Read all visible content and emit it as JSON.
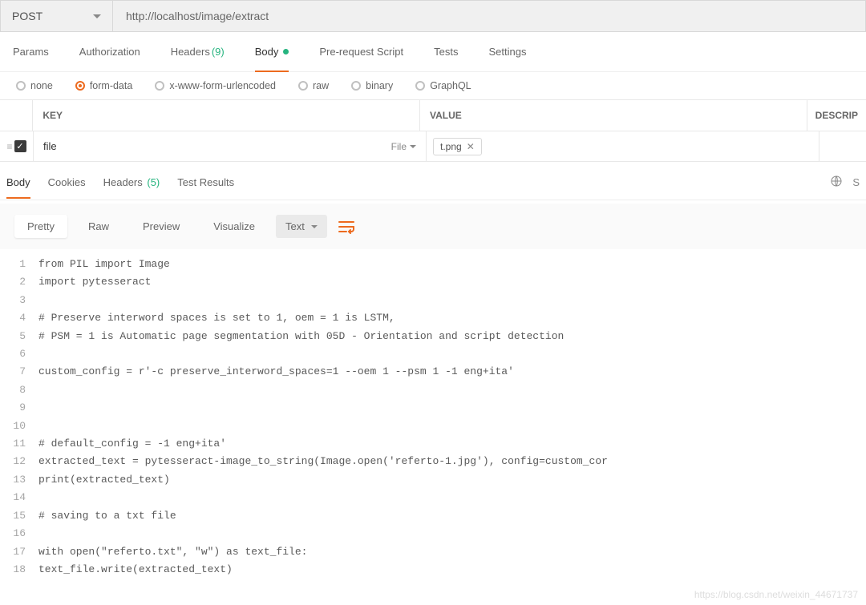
{
  "url_bar": {
    "method": "POST",
    "url": "http://localhost/image/extract"
  },
  "request_tabs": {
    "params": "Params",
    "authorization": "Authorization",
    "headers": "Headers",
    "headers_count": "(9)",
    "body": "Body",
    "prerequest": "Pre-request Script",
    "tests": "Tests",
    "settings": "Settings"
  },
  "body_types": {
    "none": "none",
    "form_data": "form-data",
    "x_www": "x-www-form-urlencoded",
    "raw": "raw",
    "binary": "binary",
    "graphql": "GraphQL"
  },
  "kv": {
    "key_header": "KEY",
    "value_header": "VALUE",
    "desc_header": "DESCRIP",
    "row": {
      "key": "file",
      "type_label": "File",
      "file_name": "t.png"
    }
  },
  "response_tabs": {
    "body": "Body",
    "cookies": "Cookies",
    "headers": "Headers",
    "headers_count": "(5)",
    "test_results": "Test Results"
  },
  "toolbar": {
    "pretty": "Pretty",
    "raw": "Raw",
    "preview": "Preview",
    "visualize": "Visualize",
    "text": "Text"
  },
  "code_lines": [
    "from PIL import Image",
    "import pytesseract",
    "",
    "# Preserve interword spaces is set to 1, oem = 1 is LSTM,",
    "# PSM = 1 is Automatic page segmentation with 05D - Orientation and script detection",
    "",
    "custom_config = r'-c preserve_interword_spaces=1 --oem 1 --psm 1 -1 eng+ita'",
    "",
    "",
    "",
    "# default_config = -1 eng+ita'",
    "extracted_text = pytesseract-image_to_string(Image.open('referto-1.jpg'), config=custom_cor",
    "print(extracted_text)",
    "",
    "# saving to a txt file",
    "",
    "with open(\"referto.txt\", \"w\") as text_file:",
    "text_file.write(extracted_text)"
  ],
  "watermark": "https://blog.csdn.net/weixin_44671737"
}
